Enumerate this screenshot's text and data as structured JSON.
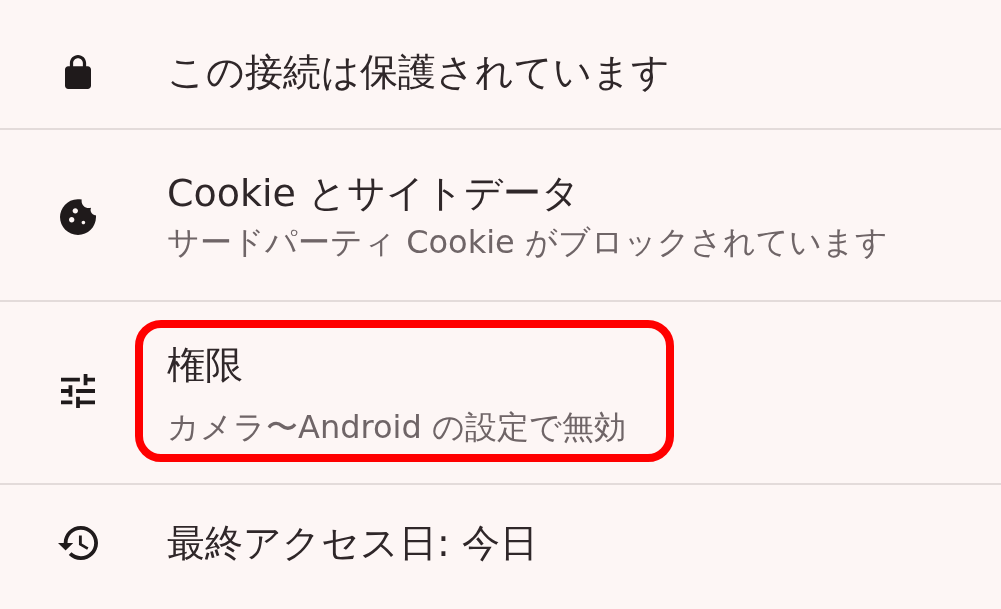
{
  "items": [
    {
      "title": "この接続は保護されています",
      "highlighted": false
    },
    {
      "title": "Cookie とサイトデータ",
      "subtitle": "サードパーティ Cookie がブロックされています",
      "highlighted": false
    },
    {
      "title": "権限",
      "subtitle": "カメラ〜Android の設定で無効",
      "highlighted": true
    },
    {
      "title": "最終アクセス日: 今日",
      "highlighted": false
    }
  ]
}
